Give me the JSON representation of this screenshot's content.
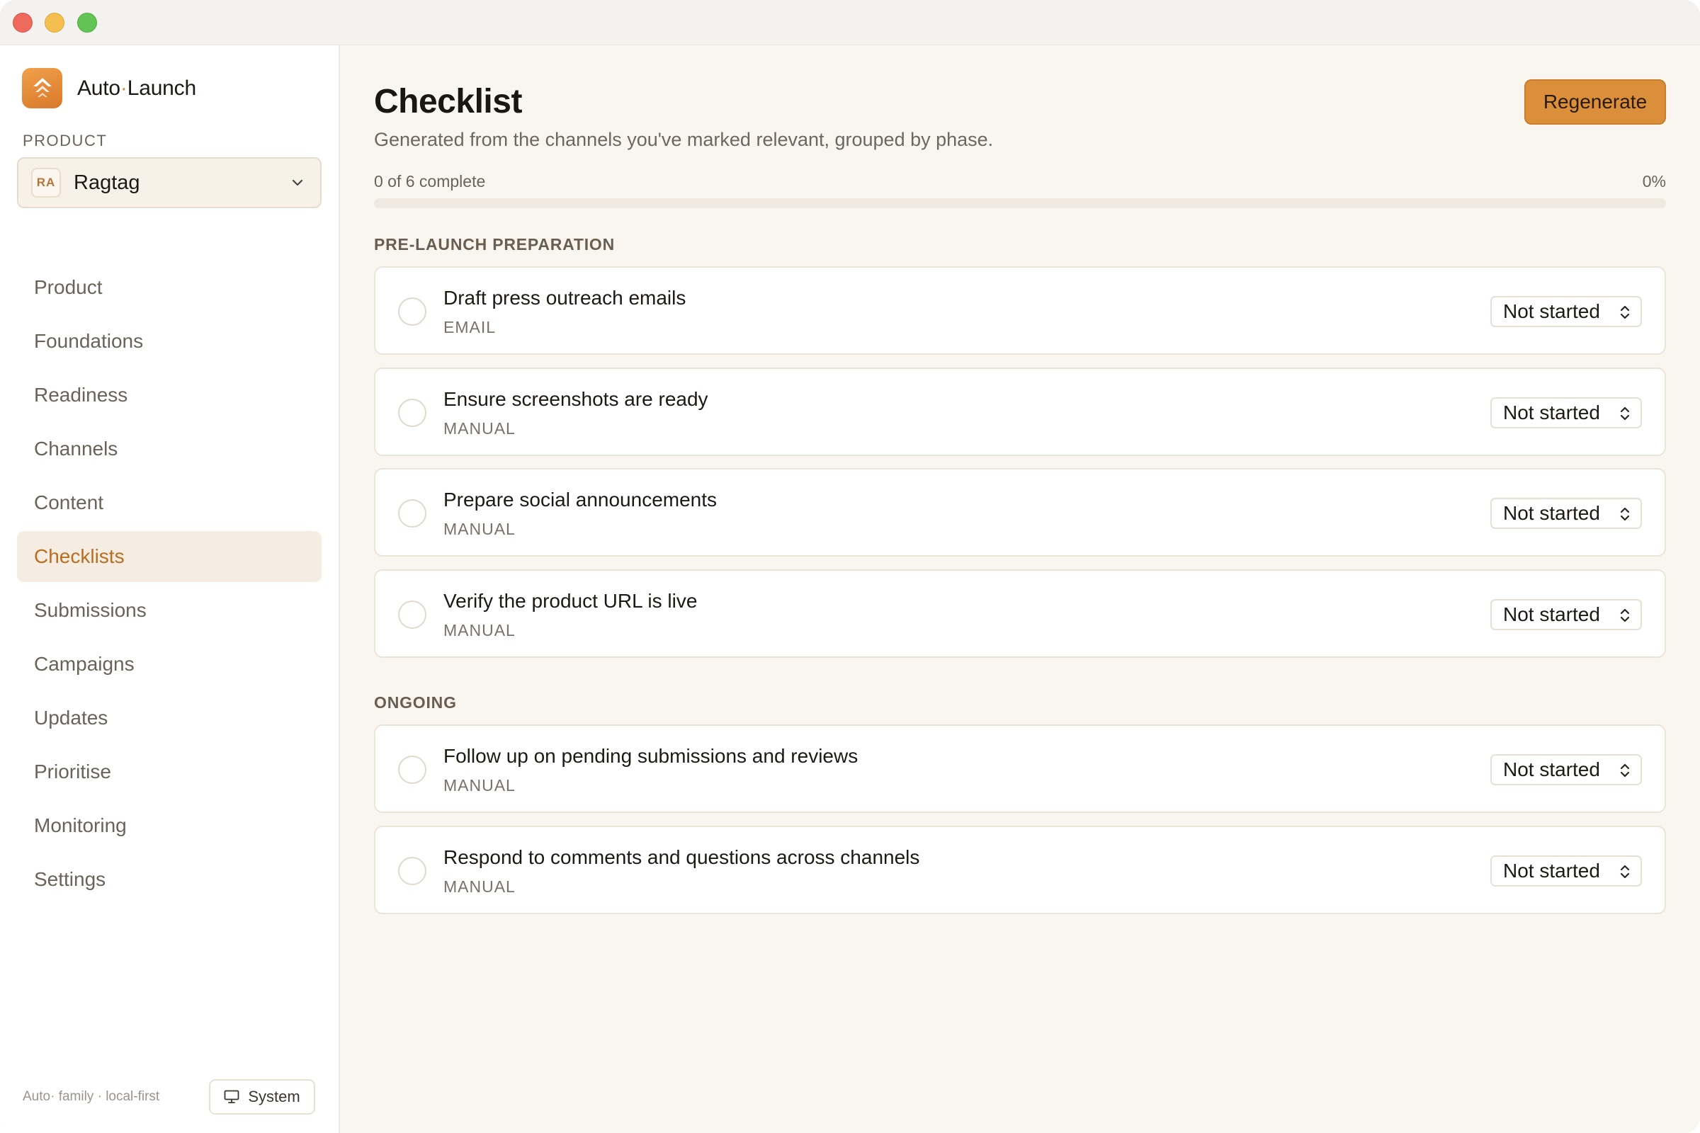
{
  "app": {
    "brand_prefix": "Auto",
    "brand_dot": "·",
    "brand_suffix": "Launch",
    "accent": "#db8f3b"
  },
  "sidebar": {
    "product_label": "PRODUCT",
    "product": {
      "initials": "RA",
      "name": "Ragtag"
    },
    "items": [
      {
        "label": "Product",
        "active": false
      },
      {
        "label": "Foundations",
        "active": false
      },
      {
        "label": "Readiness",
        "active": false
      },
      {
        "label": "Channels",
        "active": false
      },
      {
        "label": "Content",
        "active": false
      },
      {
        "label": "Checklists",
        "active": true
      },
      {
        "label": "Submissions",
        "active": false
      },
      {
        "label": "Campaigns",
        "active": false
      },
      {
        "label": "Updates",
        "active": false
      },
      {
        "label": "Prioritise",
        "active": false
      },
      {
        "label": "Monitoring",
        "active": false
      },
      {
        "label": "Settings",
        "active": false
      }
    ],
    "footer_text": "Auto· family · local-first",
    "theme_button": "System"
  },
  "main": {
    "title": "Checklist",
    "subtitle": "Generated from the channels you've marked relevant, grouped by phase.",
    "regenerate_label": "Regenerate",
    "progress_label": "0 of 6 complete",
    "progress_percent_label": "0%",
    "progress_fraction": 0,
    "sections": [
      {
        "title": "PRE-LAUNCH PREPARATION",
        "tasks": [
          {
            "title": "Draft press outreach emails",
            "type": "EMAIL",
            "status": "Not started"
          },
          {
            "title": "Ensure screenshots are ready",
            "type": "MANUAL",
            "status": "Not started"
          },
          {
            "title": "Prepare social announcements",
            "type": "MANUAL",
            "status": "Not started"
          },
          {
            "title": "Verify the product URL is live",
            "type": "MANUAL",
            "status": "Not started"
          }
        ]
      },
      {
        "title": "ONGOING",
        "tasks": [
          {
            "title": "Follow up on pending submissions and reviews",
            "type": "MANUAL",
            "status": "Not started"
          },
          {
            "title": "Respond to comments and questions across channels",
            "type": "MANUAL",
            "status": "Not started"
          }
        ]
      }
    ]
  }
}
